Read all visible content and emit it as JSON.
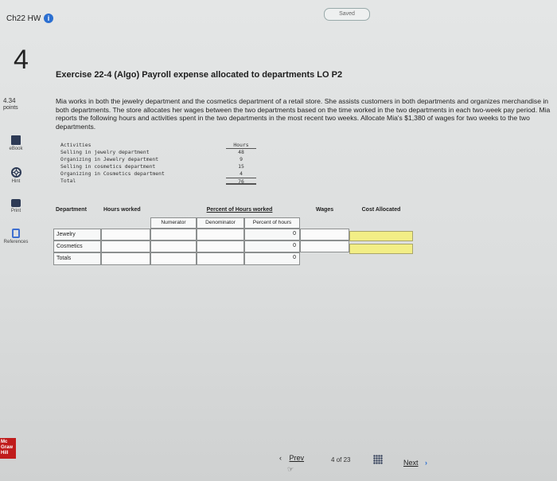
{
  "header": {
    "saved_label": "Saved",
    "hw_title": "Ch22 HW",
    "question_number": "4",
    "points_value": "4.34",
    "points_label": "points"
  },
  "sidebar": {
    "ebook": "eBook",
    "hint": "Hint",
    "print": "Print",
    "references": "References"
  },
  "logo": {
    "line1": "Mc",
    "line2": "Graw",
    "line3": "Hill"
  },
  "exercise": {
    "title": "Exercise 22-4 (Algo) Payroll expense allocated to departments LO P2",
    "intro": "Mia works in both the jewelry department and the cosmetics department of a retail store. She assists customers in both departments and organizes merchandise in both departments. The store allocates her wages between the two departments based on the time worked in the two departments in each two-week pay period. Mia reports the following hours and activities spent in the two departments in the most recent two weeks. Allocate Mia's $1,380 of wages for two weeks to the two departments."
  },
  "activities": {
    "header": "Activities",
    "hours_header": "Hours",
    "rows": [
      {
        "activity": "Selling in jewelry department",
        "hours": "48"
      },
      {
        "activity": "Organizing in Jewelry department",
        "hours": "9"
      },
      {
        "activity": "Selling in cosmetics department",
        "hours": "15"
      },
      {
        "activity": "Organizing in Cosmetics department",
        "hours": "4"
      }
    ],
    "total_label": "Total",
    "total_hours": "76"
  },
  "allocation_table": {
    "headers": {
      "department": "Department",
      "hours_worked": "Hours worked",
      "percent": "Percent of Hours worked",
      "numerator": "Numerator",
      "denominator": "Denominator",
      "percent_of_hours": "Percent of hours",
      "wages": "Wages",
      "cost_allocated": "Cost Allocated"
    },
    "rows": [
      {
        "department": "Jewelry",
        "percent_value": "0"
      },
      {
        "department": "Cosmetics",
        "percent_value": "0"
      },
      {
        "department": "Totals",
        "percent_value": "0"
      }
    ]
  },
  "footer": {
    "prev_label": "Prev",
    "page_current": "4",
    "page_of": "of",
    "page_total": "23",
    "next_label": "Next"
  }
}
